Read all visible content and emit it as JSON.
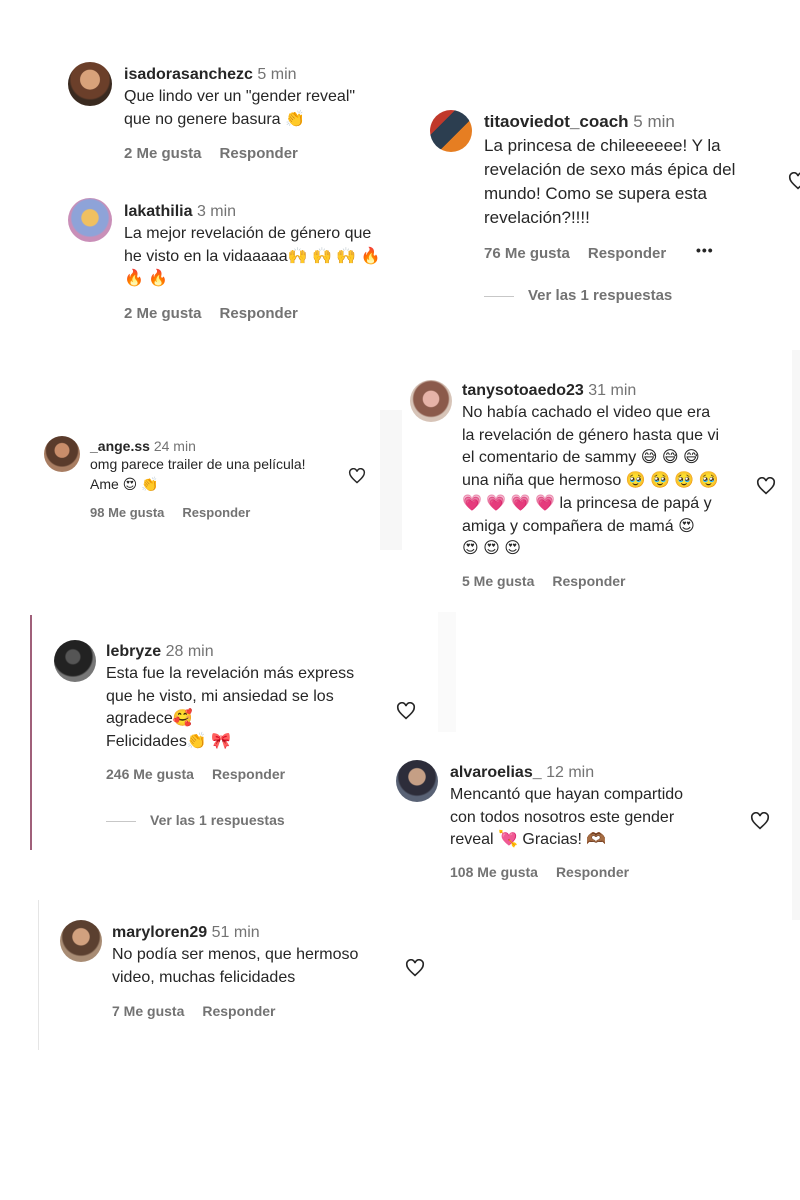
{
  "comments": [
    {
      "user": "isadorasanchezc",
      "time": "5 min",
      "lines": [
        "Que lindo ver un \"gender reveal\"",
        "que no genere basura 👏"
      ],
      "likes": "2 Me gusta",
      "reply": "Responder"
    },
    {
      "user": "titaoviedot_coach",
      "time": "5 min",
      "lines": [
        "La princesa de chileeeeee! Y la",
        "revelación de sexo más épica del",
        "mundo! Como se supera esta",
        "revelación?!!!!"
      ],
      "likes": "76 Me gusta",
      "reply": "Responder",
      "more": "•••",
      "replies": "Ver las 1 respuestas"
    },
    {
      "user": "lakathilia",
      "time": "3 min",
      "lines": [
        "La mejor revelación de género que",
        "he visto en la vidaaaaa🙌 🙌 🙌 🔥",
        "🔥 🔥"
      ],
      "likes": "2 Me gusta",
      "reply": "Responder"
    },
    {
      "user": "tanysotoaedo23",
      "time": "31 min",
      "lines": [
        "No había cachado el video que era",
        "la revelación de género hasta que vi",
        "el comentario de sammy 😅 😅 😅",
        "una niña que hermoso 🥹 🥹 🥹 🥹",
        "💗 💗 💗 💗  la princesa de papá y",
        "amiga y compañera de mamá 😍",
        "😍 😍 😍"
      ],
      "likes": "5 Me gusta",
      "reply": "Responder"
    },
    {
      "user": "_ange.ss",
      "time": "24 min",
      "lines": [
        "omg parece trailer de una película!",
        "Ame 😍 👏"
      ],
      "likes": "98 Me gusta",
      "reply": "Responder"
    },
    {
      "user": "lebryze",
      "time": "28 min",
      "lines": [
        "Esta fue la revelación más express",
        "que he visto, mi ansiedad se los",
        "agradece🥰",
        "Felicidades👏 🎀"
      ],
      "likes": "246 Me gusta",
      "reply": "Responder",
      "replies": "Ver las 1 respuestas"
    },
    {
      "user": "alvaroelias_",
      "time": "12 min",
      "lines": [
        "Mencantó que hayan compartido",
        "con todos nosotros este gender",
        "reveal 💘 Gracias! 🫶🏾"
      ],
      "likes": "108 Me gusta",
      "reply": "Responder"
    },
    {
      "user": "maryloren29",
      "time": "51 min",
      "lines": [
        "No podía ser menos, que hermoso",
        "video, muchas felicidades"
      ],
      "likes": "7 Me gusta",
      "reply": "Responder"
    }
  ],
  "colors": {
    "text": "#262626",
    "muted": "#737373",
    "accent_line": "#a0607a"
  }
}
